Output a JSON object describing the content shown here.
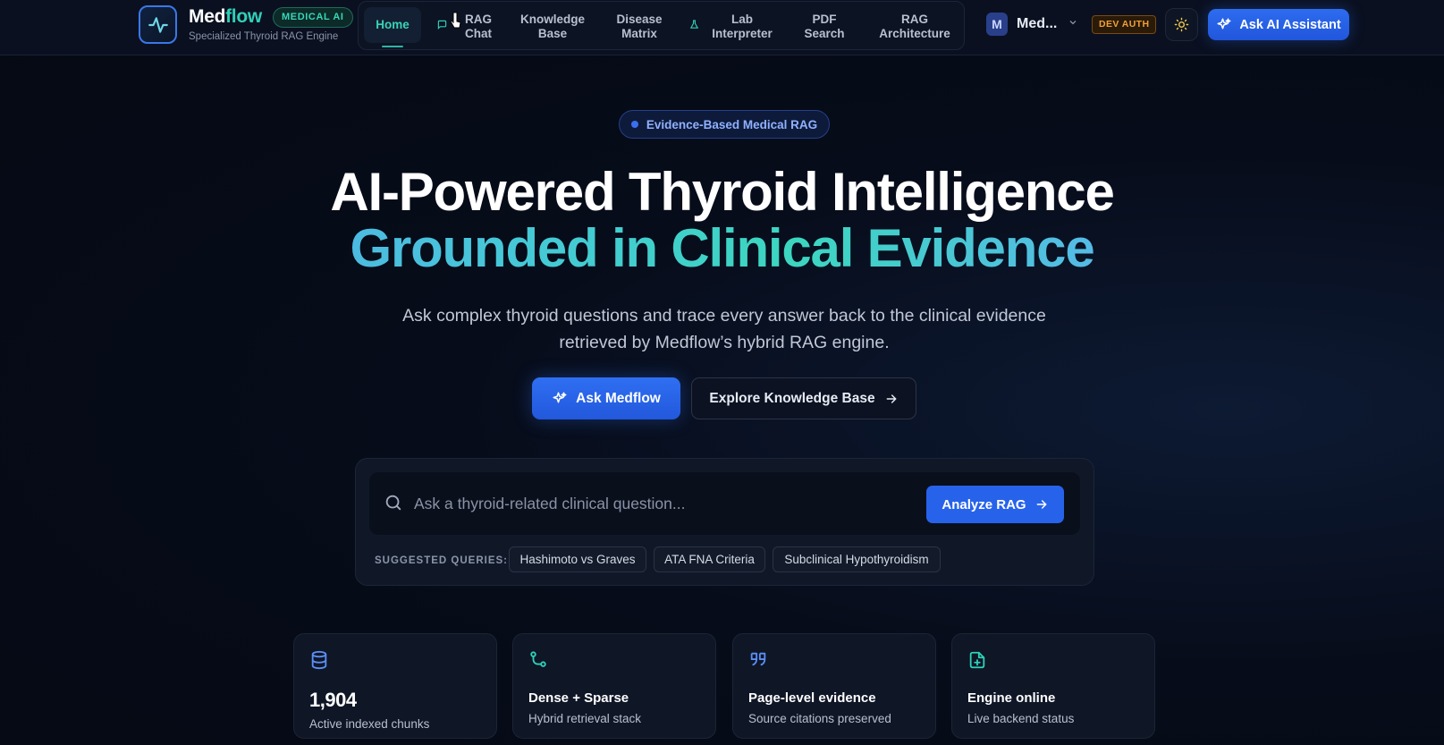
{
  "header": {
    "brand_prefix": "Med",
    "brand_accent": "flow",
    "badge": "MEDICAL AI",
    "subtitle": "Specialized Thyroid RAG Engine",
    "nav": [
      {
        "label": "Home",
        "active": true
      },
      {
        "label": "RAG Chat"
      },
      {
        "label": "Knowledge Base"
      },
      {
        "label": "Disease Matrix"
      },
      {
        "label": "Lab Interpreter"
      },
      {
        "label": "PDF Search"
      },
      {
        "label": "RAG Architecture"
      }
    ],
    "user_initial": "M",
    "user_name": "Med...",
    "dev_badge": "DEV AUTH",
    "ask_ai_label": "Ask AI Assistant"
  },
  "hero": {
    "pill": "Evidence-Based Medical RAG",
    "title_line1": "AI-Powered Thyroid Intelligence",
    "title_line2": "Grounded in Clinical Evidence",
    "description": "Ask complex thyroid questions and trace every answer back to the clinical evidence retrieved by Medflow’s hybrid RAG engine.",
    "primary_btn": "Ask Medflow",
    "secondary_btn": "Explore Knowledge Base"
  },
  "search": {
    "placeholder": "Ask a thyroid-related clinical question...",
    "analyze_btn": "Analyze RAG",
    "suggested_label": "SUGGESTED QUERIES:",
    "chips": [
      "Hashimoto vs Graves",
      "ATA FNA Criteria",
      "Subclinical Hypothyroidism"
    ]
  },
  "cards": [
    {
      "icon": "database-icon",
      "value": "1,904",
      "subtitle": "Active indexed chunks"
    },
    {
      "icon": "git-branch-icon",
      "title": "Dense + Sparse",
      "subtitle": "Hybrid retrieval stack"
    },
    {
      "icon": "quote-icon",
      "title": "Page-level evidence",
      "subtitle": "Source citations preserved"
    },
    {
      "icon": "file-plus-icon",
      "title": "Engine online",
      "subtitle": "Live backend status"
    }
  ],
  "colors": {
    "accent_teal": "#2fd0b8",
    "primary_blue": "#2763ea",
    "dev_orange": "#f0a03a"
  }
}
